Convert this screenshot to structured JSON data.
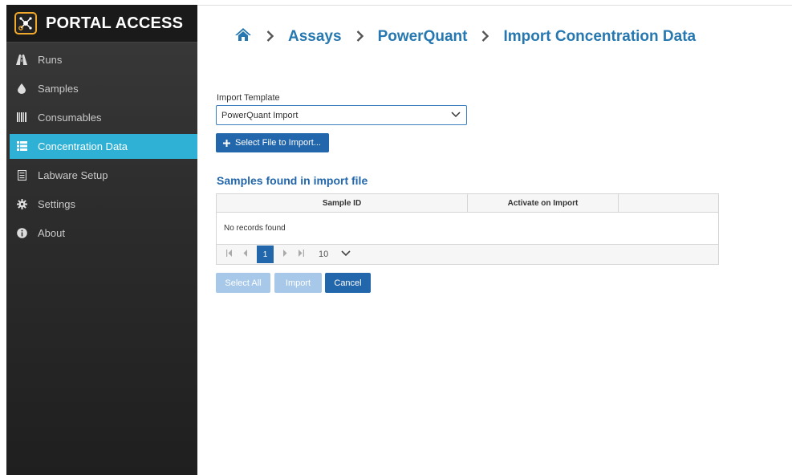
{
  "app": {
    "title": "PORTAL ACCESS",
    "accent_color": "#2fb1d5",
    "logo_color": "#f0a92b"
  },
  "sidebar": {
    "items": [
      {
        "label": "Runs",
        "icon": "road-icon",
        "active": false
      },
      {
        "label": "Samples",
        "icon": "droplet-icon",
        "active": false
      },
      {
        "label": "Consumables",
        "icon": "barcode-icon",
        "active": false
      },
      {
        "label": "Concentration Data",
        "icon": "list-icon",
        "active": true
      },
      {
        "label": "Labware Setup",
        "icon": "clipboard-icon",
        "active": false
      },
      {
        "label": "Settings",
        "icon": "gear-icon",
        "active": false
      },
      {
        "label": "About",
        "icon": "info-icon",
        "active": false
      }
    ]
  },
  "breadcrumb": {
    "home_icon": "home-icon",
    "items": [
      "Assays",
      "PowerQuant",
      "Import Concentration Data"
    ]
  },
  "form": {
    "template_label": "Import Template",
    "template_value": "PowerQuant Import",
    "select_file_label": "Select File to Import..."
  },
  "samples": {
    "title": "Samples found in import file",
    "columns": [
      "Sample ID",
      "Activate on Import",
      ""
    ],
    "empty_text": "No records found",
    "pager": {
      "current_page": "1",
      "page_size": "10"
    }
  },
  "actions": {
    "select_all_label": "Select All",
    "import_label": "Import",
    "cancel_label": "Cancel"
  }
}
